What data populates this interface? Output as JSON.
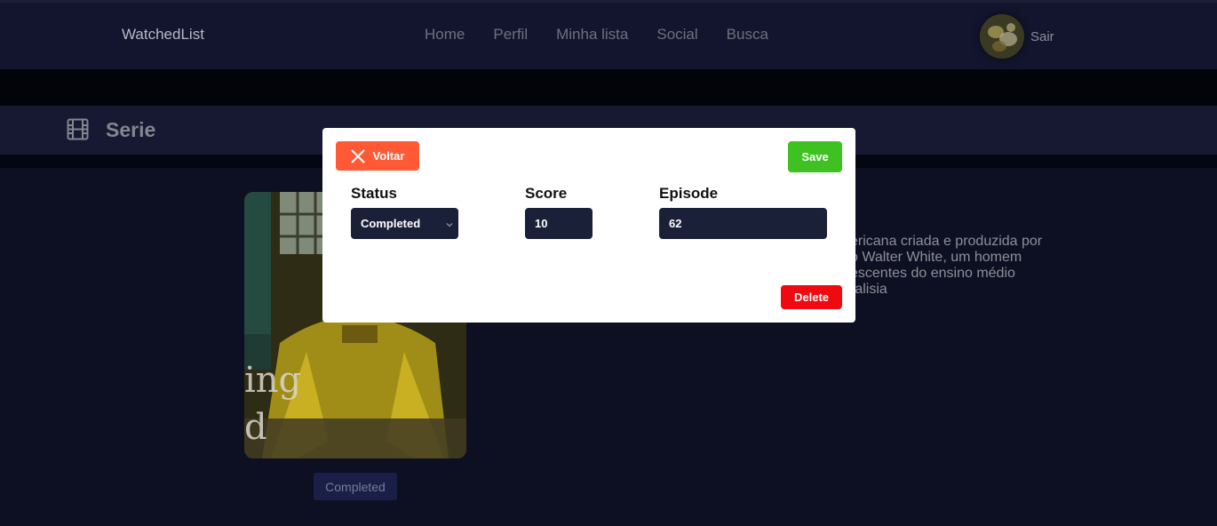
{
  "header": {
    "brand": "WatchedList",
    "nav": [
      {
        "label": "Home"
      },
      {
        "label": "Perfil"
      },
      {
        "label": "Minha lista"
      },
      {
        "label": "Social"
      },
      {
        "label": "Busca"
      }
    ],
    "logout_label": "Sair"
  },
  "section": {
    "title": "Serie",
    "icon": "film-icon"
  },
  "content": {
    "poster_text_line1": "ing",
    "poster_text_line2": "d",
    "status_badge": "Completed",
    "synopsis_lines": [
      "ericana criada e produzida por",
      "o Walter White, um homem",
      "escentes do ensino médio",
      "ralisia"
    ]
  },
  "modal": {
    "back_label": "Voltar",
    "save_label": "Save",
    "delete_label": "Delete",
    "status": {
      "label": "Status",
      "value": "Completed"
    },
    "score": {
      "label": "Score",
      "value": "10"
    },
    "episode": {
      "label": "Episode",
      "value": "62"
    }
  },
  "colors": {
    "background": "#0d0f22",
    "navbar": "#13152e",
    "back_button": "#ff5a35",
    "save_button": "#3fc221",
    "delete_button": "#ee0a10",
    "input_bg": "#1b2039"
  }
}
